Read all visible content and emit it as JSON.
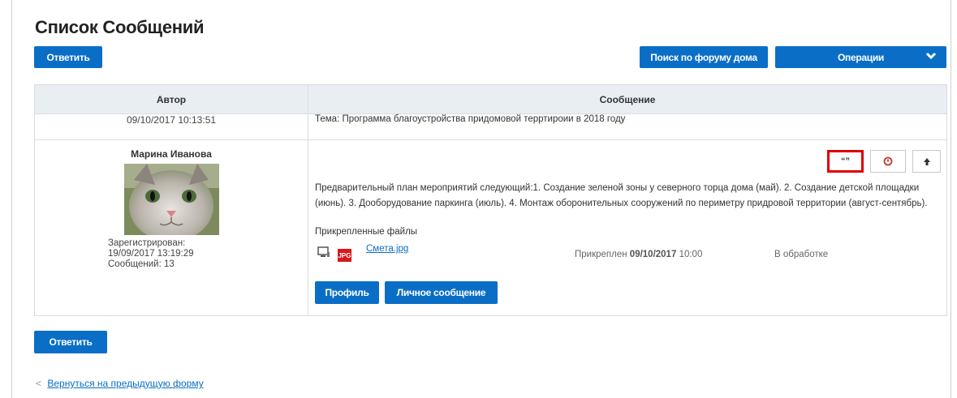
{
  "page": {
    "title": "Список Сообщений"
  },
  "toolbar": {
    "reply_label": "Ответить",
    "search_label": "Поиск по форуму дома",
    "operations_label": "Операции"
  },
  "table": {
    "headers": {
      "author": "Автор",
      "message": "Сообщение"
    },
    "topic_row": {
      "date": "09/10/2017 10:13:51",
      "topic": "Тема: Программа благоустройства придомовой терртироии в 2018 году"
    },
    "post": {
      "author_name": "Марина Иванова",
      "registered_label": "Зарегистрирован:",
      "registered_date": "19/09/2017 13:19:29",
      "messages_count": "Сообщений: 13",
      "actions": {
        "quote_glyph": "“”"
      },
      "text": "Предварительный план мероприятий следующий:1. Создание зеленой зоны у северного торца дома (май). 2. Создание детской площадки (июнь). 3. Дооборудование паркинга (июль). 4. Монтаж оборонительных сооружений по периметру придровой территории (август-сентябрь).",
      "attachments_title": "Прикрепленные файлы",
      "attachment": {
        "type_label": "JPG",
        "file_name": "Смета.jpg",
        "attached_label": "Прикреплен",
        "attached_date": "09/10/2017",
        "attached_time": "10:00",
        "status": "В обработке"
      },
      "profile_label": "Профиль",
      "pm_label": "Личное сообщение"
    }
  },
  "footer": {
    "reply_label": "Ответить",
    "back_arrow": "<",
    "back_label": "Вернуться на предыдущую форму"
  },
  "colors": {
    "primary": "#0a6ec6",
    "header_bg": "#e9eef3",
    "highlight": "#e00000",
    "danger": "#d81919"
  },
  "icons": [
    "chevron-down-icon",
    "quote-icon",
    "report-icon",
    "arrow-up-icon",
    "monitor-icon",
    "jpg-file-icon"
  ]
}
